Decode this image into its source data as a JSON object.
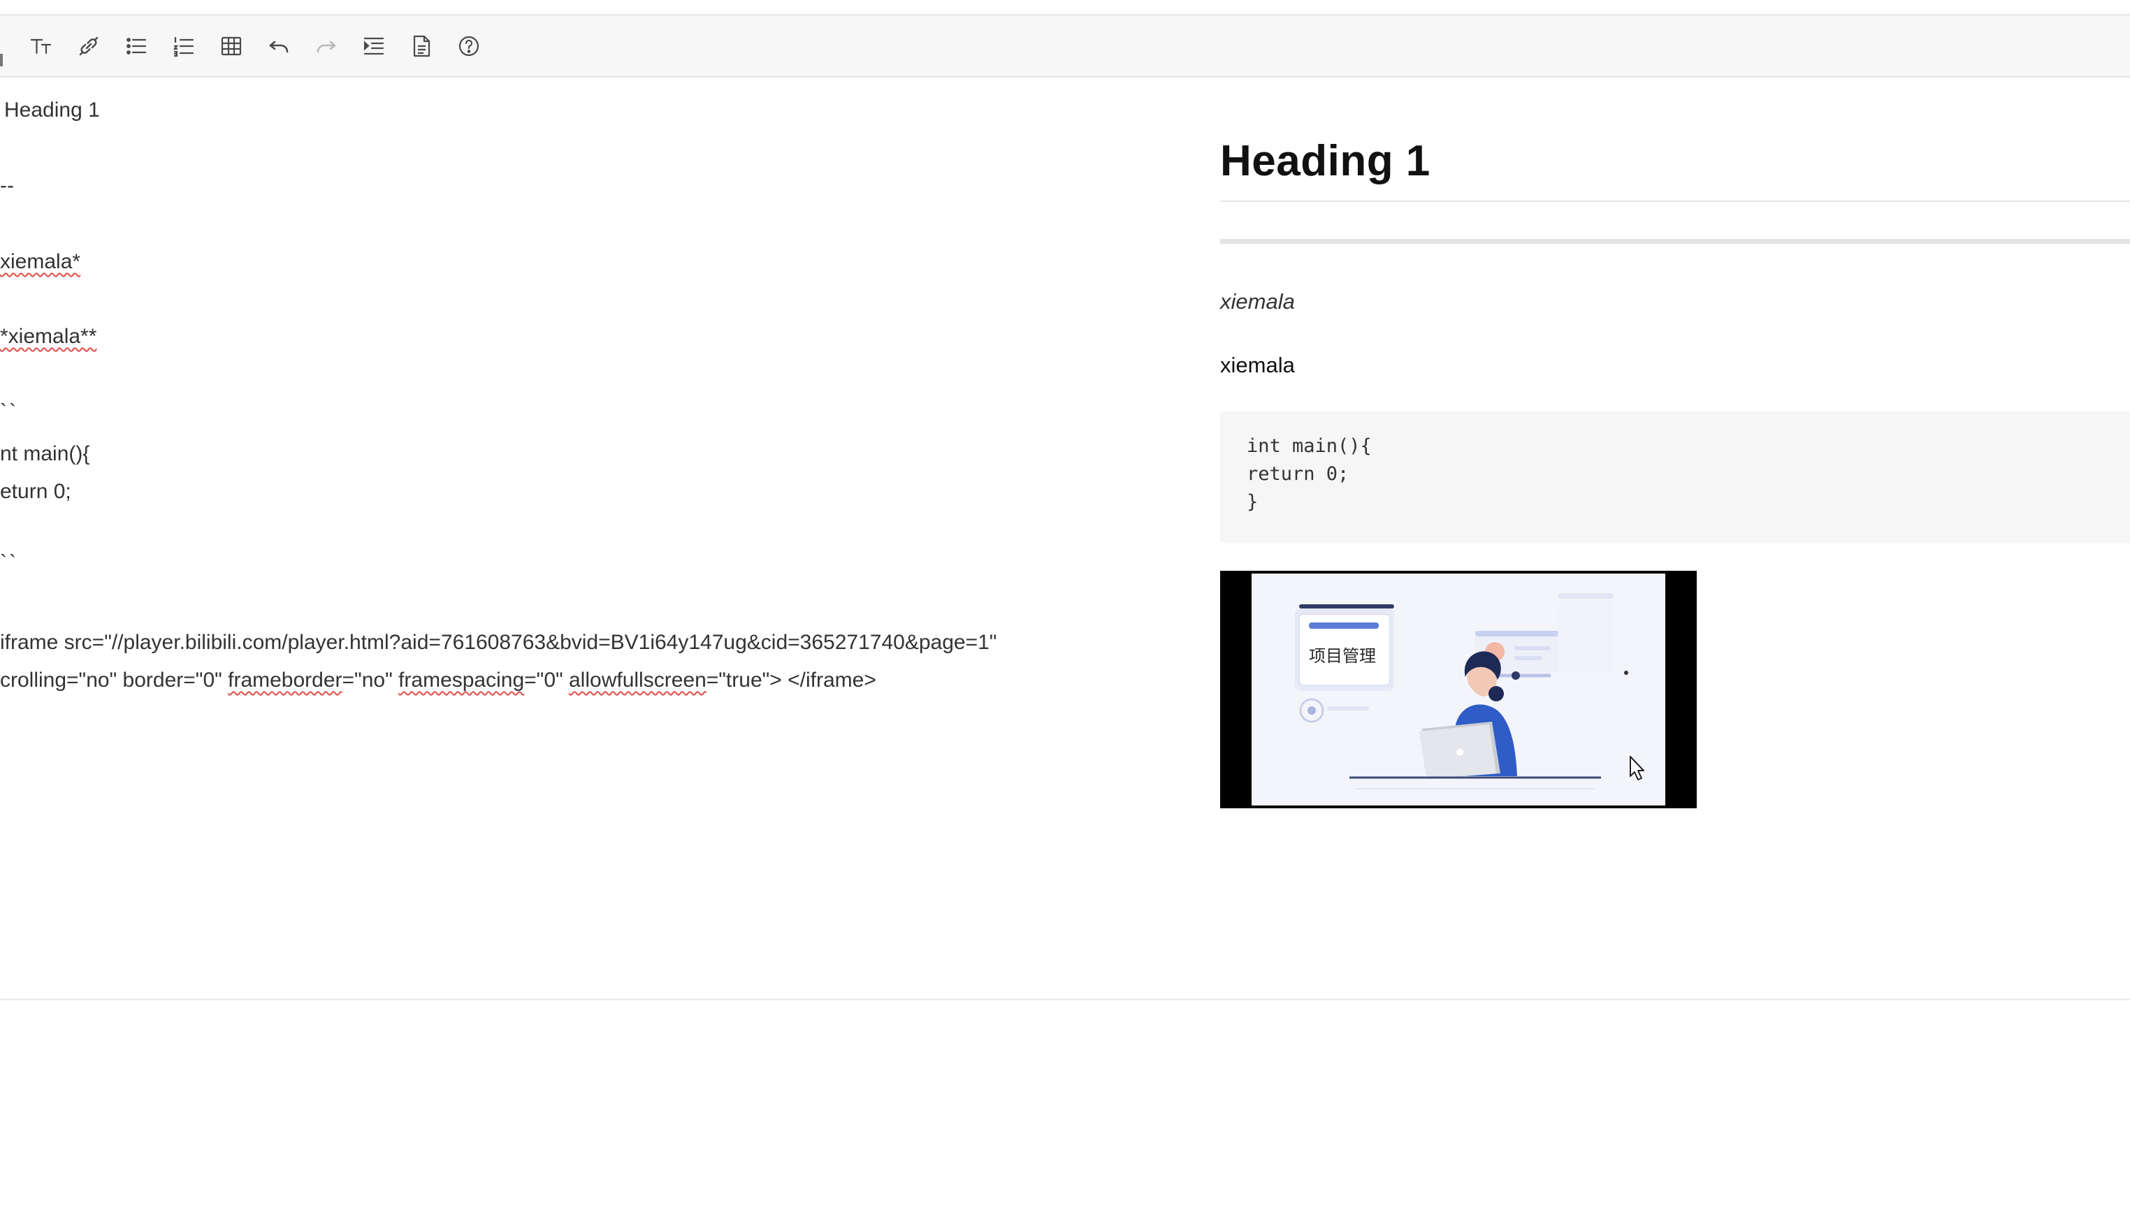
{
  "toolbar": {
    "buttons": [
      {
        "name": "text-size",
        "icon": "text-size-icon"
      },
      {
        "name": "link",
        "icon": "link-icon"
      },
      {
        "name": "bullet-list",
        "icon": "bullet-list-icon"
      },
      {
        "name": "numbered-list",
        "icon": "numbered-list-icon"
      },
      {
        "name": "table",
        "icon": "table-icon"
      },
      {
        "name": "undo",
        "icon": "undo-icon"
      },
      {
        "name": "redo",
        "icon": "redo-icon",
        "disabled": true
      },
      {
        "name": "indent",
        "icon": "indent-icon"
      },
      {
        "name": "document",
        "icon": "document-icon"
      },
      {
        "name": "help",
        "icon": "help-icon"
      }
    ],
    "bg_color": "#f7f7f7"
  },
  "editor": {
    "lines": [
      "Heading 1",
      "--",
      "xiemala*",
      "*xiemala**",
      "``",
      "nt main(){",
      "eturn 0;",
      "``",
      "iframe src=\"//player.bilibili.com/player.html?aid=761608763&bvid=BV1i64y147ug&cid=365271740&page=1\"",
      "crolling=\"no\" border=\"0\" ",
      "frameborder",
      "=\"no\" ",
      "framespacing",
      "=\"0\" ",
      "allowfullscreen",
      "=\"true\"> </iframe>"
    ]
  },
  "preview": {
    "heading": "Heading 1",
    "italic_text": "xiemala",
    "bold_text": "xiemala",
    "code": "int main(){\nreturn 0;\n}",
    "video": {
      "thumbnail_caption": "项目管理"
    }
  },
  "colors": {
    "spellcheck_underline": "#e34b4b",
    "code_bg": "#f6f6f6",
    "divider": "#ececec"
  }
}
